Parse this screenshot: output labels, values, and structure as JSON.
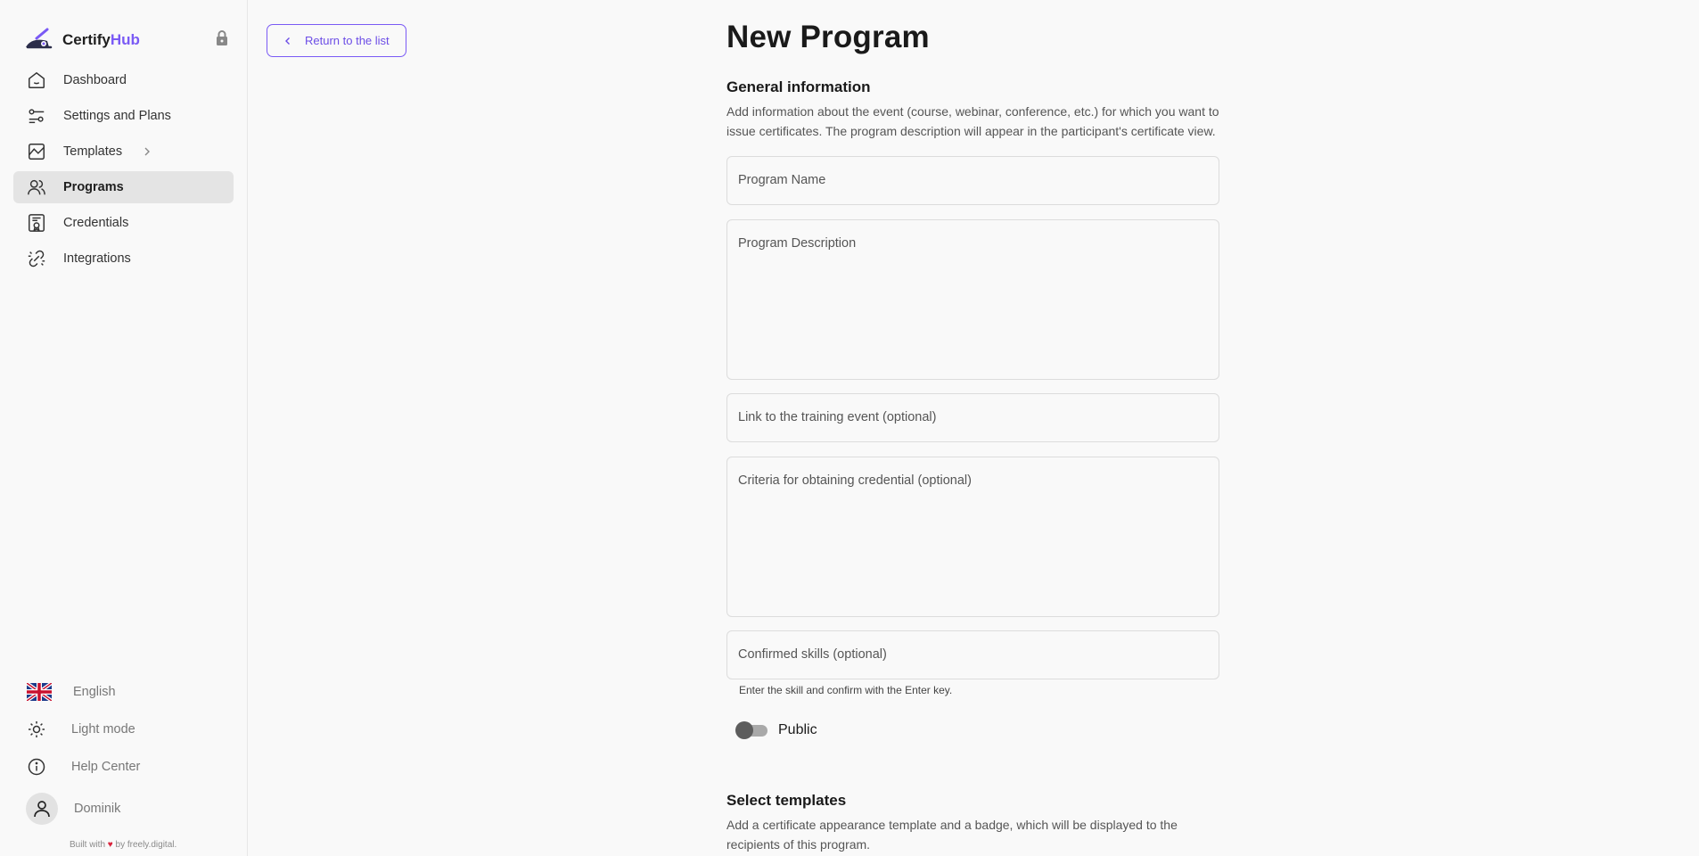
{
  "brand": {
    "name_part1": "Certify",
    "name_part2": "Hub"
  },
  "sidebar": {
    "items": [
      {
        "label": "Dashboard"
      },
      {
        "label": "Settings and Plans"
      },
      {
        "label": "Templates"
      },
      {
        "label": "Programs"
      },
      {
        "label": "Credentials"
      },
      {
        "label": "Integrations"
      }
    ],
    "active": "Programs",
    "bottom": {
      "language": "English",
      "theme": "Light mode",
      "help": "Help Center",
      "user": "Dominik"
    },
    "credit": {
      "prefix": "Built with",
      "suffix": "by freely.digital."
    }
  },
  "back_button": {
    "label": "Return to the list"
  },
  "page": {
    "title": "New Program"
  },
  "general": {
    "title": "General information",
    "description": "Add information about the event (course, webinar, conference, etc.) for which you want to issue certificates. The program description will appear in the participant's certificate view."
  },
  "fields": {
    "program_name": {
      "placeholder": "Program Name",
      "value": ""
    },
    "program_description": {
      "placeholder": "Program Description",
      "value": ""
    },
    "training_link": {
      "placeholder": "Link to the training event (optional)",
      "value": ""
    },
    "criteria": {
      "placeholder": "Criteria for obtaining credential (optional)",
      "value": ""
    },
    "skills": {
      "placeholder": "Confirmed skills (optional)",
      "value": "",
      "hint": "Enter the skill and confirm with the Enter key."
    }
  },
  "public_toggle": {
    "label": "Public",
    "on": false
  },
  "templates_section": {
    "title": "Select templates",
    "description": "Add a certificate appearance template and a badge, which will be displayed to the recipients of this program."
  },
  "colors": {
    "accent": "#7a5af5",
    "active_nav_bg": "#e4e4e4",
    "heart": "#d9233b"
  }
}
